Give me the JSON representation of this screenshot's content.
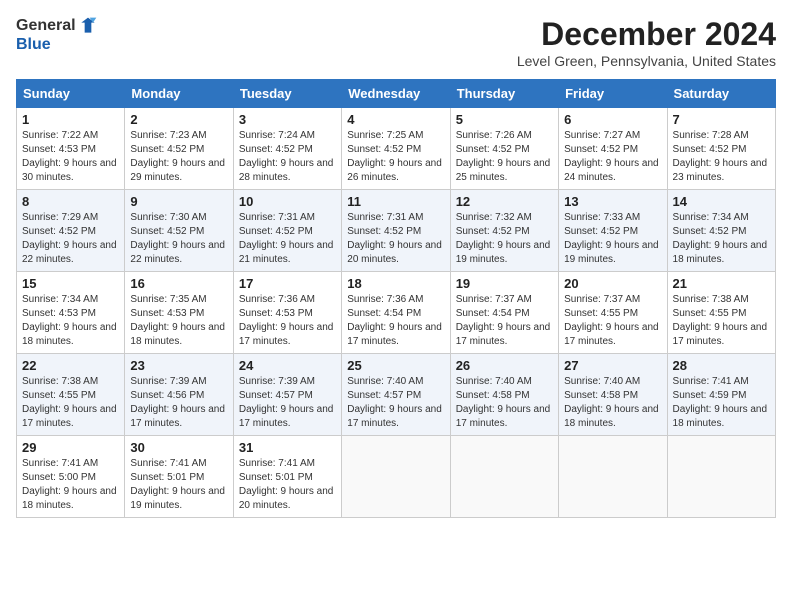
{
  "header": {
    "logo_general": "General",
    "logo_blue": "Blue",
    "month_title": "December 2024",
    "location": "Level Green, Pennsylvania, United States"
  },
  "weekdays": [
    "Sunday",
    "Monday",
    "Tuesday",
    "Wednesday",
    "Thursday",
    "Friday",
    "Saturday"
  ],
  "weeks": [
    [
      {
        "day": "1",
        "sunrise": "Sunrise: 7:22 AM",
        "sunset": "Sunset: 4:53 PM",
        "daylight": "Daylight: 9 hours and 30 minutes."
      },
      {
        "day": "2",
        "sunrise": "Sunrise: 7:23 AM",
        "sunset": "Sunset: 4:52 PM",
        "daylight": "Daylight: 9 hours and 29 minutes."
      },
      {
        "day": "3",
        "sunrise": "Sunrise: 7:24 AM",
        "sunset": "Sunset: 4:52 PM",
        "daylight": "Daylight: 9 hours and 28 minutes."
      },
      {
        "day": "4",
        "sunrise": "Sunrise: 7:25 AM",
        "sunset": "Sunset: 4:52 PM",
        "daylight": "Daylight: 9 hours and 26 minutes."
      },
      {
        "day": "5",
        "sunrise": "Sunrise: 7:26 AM",
        "sunset": "Sunset: 4:52 PM",
        "daylight": "Daylight: 9 hours and 25 minutes."
      },
      {
        "day": "6",
        "sunrise": "Sunrise: 7:27 AM",
        "sunset": "Sunset: 4:52 PM",
        "daylight": "Daylight: 9 hours and 24 minutes."
      },
      {
        "day": "7",
        "sunrise": "Sunrise: 7:28 AM",
        "sunset": "Sunset: 4:52 PM",
        "daylight": "Daylight: 9 hours and 23 minutes."
      }
    ],
    [
      {
        "day": "8",
        "sunrise": "Sunrise: 7:29 AM",
        "sunset": "Sunset: 4:52 PM",
        "daylight": "Daylight: 9 hours and 22 minutes."
      },
      {
        "day": "9",
        "sunrise": "Sunrise: 7:30 AM",
        "sunset": "Sunset: 4:52 PM",
        "daylight": "Daylight: 9 hours and 22 minutes."
      },
      {
        "day": "10",
        "sunrise": "Sunrise: 7:31 AM",
        "sunset": "Sunset: 4:52 PM",
        "daylight": "Daylight: 9 hours and 21 minutes."
      },
      {
        "day": "11",
        "sunrise": "Sunrise: 7:31 AM",
        "sunset": "Sunset: 4:52 PM",
        "daylight": "Daylight: 9 hours and 20 minutes."
      },
      {
        "day": "12",
        "sunrise": "Sunrise: 7:32 AM",
        "sunset": "Sunset: 4:52 PM",
        "daylight": "Daylight: 9 hours and 19 minutes."
      },
      {
        "day": "13",
        "sunrise": "Sunrise: 7:33 AM",
        "sunset": "Sunset: 4:52 PM",
        "daylight": "Daylight: 9 hours and 19 minutes."
      },
      {
        "day": "14",
        "sunrise": "Sunrise: 7:34 AM",
        "sunset": "Sunset: 4:52 PM",
        "daylight": "Daylight: 9 hours and 18 minutes."
      }
    ],
    [
      {
        "day": "15",
        "sunrise": "Sunrise: 7:34 AM",
        "sunset": "Sunset: 4:53 PM",
        "daylight": "Daylight: 9 hours and 18 minutes."
      },
      {
        "day": "16",
        "sunrise": "Sunrise: 7:35 AM",
        "sunset": "Sunset: 4:53 PM",
        "daylight": "Daylight: 9 hours and 18 minutes."
      },
      {
        "day": "17",
        "sunrise": "Sunrise: 7:36 AM",
        "sunset": "Sunset: 4:53 PM",
        "daylight": "Daylight: 9 hours and 17 minutes."
      },
      {
        "day": "18",
        "sunrise": "Sunrise: 7:36 AM",
        "sunset": "Sunset: 4:54 PM",
        "daylight": "Daylight: 9 hours and 17 minutes."
      },
      {
        "day": "19",
        "sunrise": "Sunrise: 7:37 AM",
        "sunset": "Sunset: 4:54 PM",
        "daylight": "Daylight: 9 hours and 17 minutes."
      },
      {
        "day": "20",
        "sunrise": "Sunrise: 7:37 AM",
        "sunset": "Sunset: 4:55 PM",
        "daylight": "Daylight: 9 hours and 17 minutes."
      },
      {
        "day": "21",
        "sunrise": "Sunrise: 7:38 AM",
        "sunset": "Sunset: 4:55 PM",
        "daylight": "Daylight: 9 hours and 17 minutes."
      }
    ],
    [
      {
        "day": "22",
        "sunrise": "Sunrise: 7:38 AM",
        "sunset": "Sunset: 4:55 PM",
        "daylight": "Daylight: 9 hours and 17 minutes."
      },
      {
        "day": "23",
        "sunrise": "Sunrise: 7:39 AM",
        "sunset": "Sunset: 4:56 PM",
        "daylight": "Daylight: 9 hours and 17 minutes."
      },
      {
        "day": "24",
        "sunrise": "Sunrise: 7:39 AM",
        "sunset": "Sunset: 4:57 PM",
        "daylight": "Daylight: 9 hours and 17 minutes."
      },
      {
        "day": "25",
        "sunrise": "Sunrise: 7:40 AM",
        "sunset": "Sunset: 4:57 PM",
        "daylight": "Daylight: 9 hours and 17 minutes."
      },
      {
        "day": "26",
        "sunrise": "Sunrise: 7:40 AM",
        "sunset": "Sunset: 4:58 PM",
        "daylight": "Daylight: 9 hours and 17 minutes."
      },
      {
        "day": "27",
        "sunrise": "Sunrise: 7:40 AM",
        "sunset": "Sunset: 4:58 PM",
        "daylight": "Daylight: 9 hours and 18 minutes."
      },
      {
        "day": "28",
        "sunrise": "Sunrise: 7:41 AM",
        "sunset": "Sunset: 4:59 PM",
        "daylight": "Daylight: 9 hours and 18 minutes."
      }
    ],
    [
      {
        "day": "29",
        "sunrise": "Sunrise: 7:41 AM",
        "sunset": "Sunset: 5:00 PM",
        "daylight": "Daylight: 9 hours and 18 minutes."
      },
      {
        "day": "30",
        "sunrise": "Sunrise: 7:41 AM",
        "sunset": "Sunset: 5:01 PM",
        "daylight": "Daylight: 9 hours and 19 minutes."
      },
      {
        "day": "31",
        "sunrise": "Sunrise: 7:41 AM",
        "sunset": "Sunset: 5:01 PM",
        "daylight": "Daylight: 9 hours and 20 minutes."
      },
      null,
      null,
      null,
      null
    ]
  ]
}
